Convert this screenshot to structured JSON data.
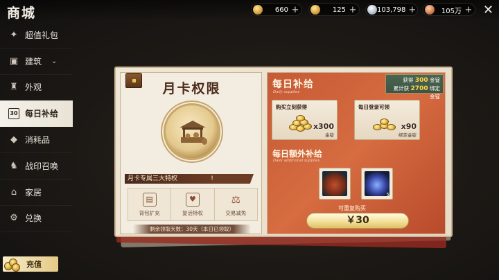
{
  "header": {
    "title": "商城",
    "currencies": [
      {
        "icon": "gold-coin-icon",
        "value": "660"
      },
      {
        "icon": "gold-ingot-icon",
        "value": "125"
      },
      {
        "icon": "silver-coin-icon",
        "value": "103,798"
      },
      {
        "icon": "copper-coin-icon",
        "value": "105万"
      }
    ],
    "plus": "+",
    "close": "✕"
  },
  "sidebar": {
    "items": [
      {
        "label": "超值礼包",
        "icon": "gift-pack-icon"
      },
      {
        "label": "建筑",
        "icon": "building-icon",
        "chevron": "⌄"
      },
      {
        "label": "外观",
        "icon": "outfit-icon"
      },
      {
        "label": "每日补给",
        "icon": "calendar-icon",
        "badge": "30"
      },
      {
        "label": "消耗品",
        "icon": "gem-icon"
      },
      {
        "label": "战印召唤",
        "icon": "horse-icon"
      },
      {
        "label": "家居",
        "icon": "furniture-icon"
      },
      {
        "label": "兑换",
        "icon": "exchange-icon"
      }
    ],
    "recharge_label": "充值"
  },
  "card": {
    "title": "月卡权限",
    "privilege_header": "月卡专属三大特权",
    "privilege_mark": "!",
    "perks": [
      {
        "label": "背包扩充",
        "icon": "backpack-icon"
      },
      {
        "label": "复活特权",
        "icon": "heart-icon"
      },
      {
        "label": "交易减免",
        "icon": "scales-icon"
      }
    ],
    "remaining": "剩余领取天数：30天（本日已领取）"
  },
  "daily": {
    "title": "每日补给",
    "subtitle": "Daily supplies",
    "gain_line1_prefix": "获得",
    "gain_line1_value": "300",
    "gain_line1_suffix": "金锭",
    "gain_line2_prefix": "累计获",
    "gain_line2_value": "2700",
    "gain_line2_suffix": "绑定金锭",
    "rewards": [
      {
        "title": "购买立刻获得",
        "amount": "x300",
        "unit": "金锭"
      },
      {
        "title": "每日登录可领",
        "amount": "x90",
        "unit": "绑定金锭"
      }
    ],
    "extra_title": "每日额外补给",
    "extra_subtitle": "Daily additional supplies",
    "extra_items": [
      {
        "icon": "food-basket-icon"
      },
      {
        "icon": "potion-icon",
        "count": "5"
      }
    ],
    "repurchase": "可重复购买",
    "price": "￥30"
  }
}
